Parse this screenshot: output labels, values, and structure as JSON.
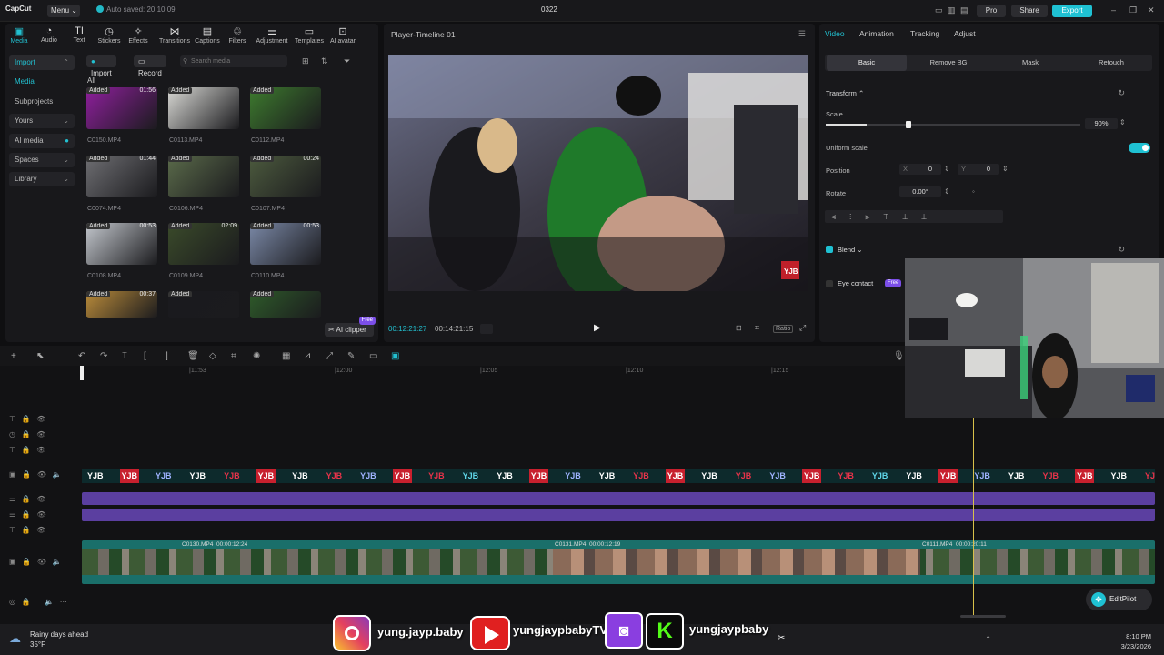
{
  "titlebar": {
    "app_logo": "CapCut",
    "menu_label": "Menu",
    "autosave_text": "Auto saved: 20:10:09",
    "project_title": "0322",
    "pro_label": "Pro",
    "share_label": "Share",
    "export_label": "Export"
  },
  "media_toolbar": [
    {
      "label": "Media",
      "icon": "media-icon"
    },
    {
      "label": "Audio",
      "icon": "audio-icon"
    },
    {
      "label": "Text",
      "icon": "text-icon"
    },
    {
      "label": "Stickers",
      "icon": "stickers-icon"
    },
    {
      "label": "Effects",
      "icon": "effects-icon"
    },
    {
      "label": "Transitions",
      "icon": "transitions-icon"
    },
    {
      "label": "Captions",
      "icon": "captions-icon"
    },
    {
      "label": "Filters",
      "icon": "filters-icon"
    },
    {
      "label": "Adjustment",
      "icon": "adjustment-icon"
    },
    {
      "label": "Templates",
      "icon": "templates-icon"
    },
    {
      "label": "AI avatar",
      "icon": "ai-avatar-icon"
    }
  ],
  "sidenav": {
    "import": "Import",
    "media": "Media",
    "subprojects": "Subprojects",
    "yours": "Yours",
    "ai_media": "AI media",
    "spaces": "Spaces",
    "library": "Library"
  },
  "media_bar": {
    "import_label": "Import",
    "record_label": "Record",
    "search_placeholder": "Search media",
    "all_label": "All",
    "ai_clipper_label": "AI clipper",
    "ai_clipper_badge": "Free"
  },
  "media_items": [
    {
      "badge": "Added",
      "duration": "01:56",
      "name": "C0150.MP4"
    },
    {
      "badge": "Added",
      "duration": "",
      "name": "C0113.MP4"
    },
    {
      "badge": "Added",
      "duration": "",
      "name": "C0112.MP4"
    },
    {
      "badge": "Added",
      "duration": "01:44",
      "name": "C0074.MP4"
    },
    {
      "badge": "Added",
      "duration": "",
      "name": "C0106.MP4"
    },
    {
      "badge": "Added",
      "duration": "00:24",
      "name": "C0107.MP4"
    },
    {
      "badge": "Added",
      "duration": "00:53",
      "name": "C0108.MP4"
    },
    {
      "badge": "Added",
      "duration": "02:09",
      "name": "C0109.MP4"
    },
    {
      "badge": "Added",
      "duration": "00:53",
      "name": "C0110.MP4"
    },
    {
      "badge": "Added",
      "duration": "00:37",
      "name": ""
    },
    {
      "badge": "Added",
      "duration": "",
      "name": ""
    },
    {
      "badge": "Added",
      "duration": "",
      "name": ""
    }
  ],
  "player": {
    "title": "Player-Timeline 01",
    "current_time": "00:12:21:27",
    "total_time": "00:14:21:15",
    "watermark": "YJB",
    "ratio_label": "Ratio"
  },
  "inspector": {
    "tabs": [
      "Video",
      "Animation",
      "Tracking",
      "Adjust"
    ],
    "subtabs": [
      "Basic",
      "Remove BG",
      "Mask",
      "Retouch"
    ],
    "transform_label": "Transform",
    "scale_label": "Scale",
    "scale_value": "90%",
    "scale_fraction": 0.9,
    "uniform_scale_label": "Uniform scale",
    "position_label": "Position",
    "pos_x_label": "X",
    "pos_x": "0",
    "pos_y_label": "Y",
    "pos_y": "0",
    "rotate_label": "Rotate",
    "rotate_value": "0.00°",
    "blend_label": "Blend",
    "eye_contact_label": "Eye contact",
    "eye_contact_badge": "Free"
  },
  "timeline": {
    "ruler_ticks": [
      "|11:53",
      "|12:00",
      "|12:05",
      "|12:10",
      "|12:15"
    ],
    "clips": [
      {
        "name": "C0130.MP4",
        "time": "00:00:12:24"
      },
      {
        "name": "C0131.MP4",
        "time": "00:00:12:19"
      },
      {
        "name": "C0111.MP4",
        "time": "00:00:20:11"
      }
    ],
    "logo_strip_text": "YJB"
  },
  "editpilot_label": "EditPilot",
  "overlay_socials": {
    "instagram": "yung.jayp.baby",
    "youtube": "yungjaypbabyTV",
    "kick_twitch": "yungjaypbaby"
  },
  "taskbar": {
    "weather_title": "Rainy days ahead",
    "weather_temp": "35°F",
    "time": "8:10 PM",
    "date": "3/23/2026"
  },
  "colors": {
    "accent": "#1fc1d3",
    "purple_track": "#5b3fa0",
    "teal_track": "#1a6f6a"
  }
}
